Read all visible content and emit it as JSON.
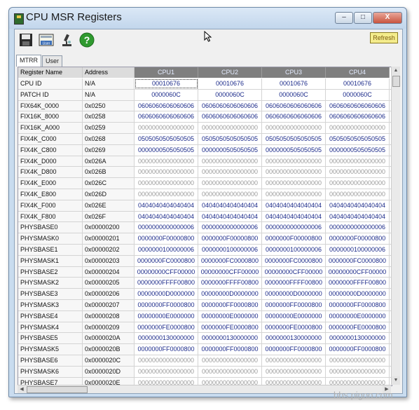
{
  "window": {
    "title": "CPU MSR Registers",
    "min": "–",
    "max": "□",
    "close": "X"
  },
  "toolbar": {
    "refresh_label": "Refresh",
    "user_label": "User",
    "help_label": "?"
  },
  "tabs": [
    {
      "label": "MTRR",
      "active": true
    },
    {
      "label": "User",
      "active": false
    }
  ],
  "columns": {
    "name": "Register Name",
    "address": "Address",
    "cpus": [
      "CPU1",
      "CPU2",
      "CPU3",
      "CPU4"
    ]
  },
  "rows": [
    {
      "name": "CPU ID",
      "address": "N/A",
      "value": "00010676"
    },
    {
      "name": "PATCH ID",
      "address": "N/A",
      "value": "0000060C"
    },
    {
      "name": "FIX64K_0000",
      "address": "0x0250",
      "value": "0606060606060606"
    },
    {
      "name": "FIX16K_8000",
      "address": "0x0258",
      "value": "0606060606060606"
    },
    {
      "name": "FIX16K_A000",
      "address": "0x0259",
      "value": "0000000000000000"
    },
    {
      "name": "FIX4K_C000",
      "address": "0x0268",
      "value": "0505050505050505"
    },
    {
      "name": "FIX4K_C800",
      "address": "0x0269",
      "value": "0000000505050505"
    },
    {
      "name": "FIX4K_D000",
      "address": "0x026A",
      "value": "0000000000000000"
    },
    {
      "name": "FIX4K_D800",
      "address": "0x026B",
      "value": "0000000000000000"
    },
    {
      "name": "FIX4K_E000",
      "address": "0x026C",
      "value": "0000000000000000"
    },
    {
      "name": "FIX4K_E800",
      "address": "0x026D",
      "value": "0000000000000000"
    },
    {
      "name": "FIX4K_F000",
      "address": "0x026E",
      "value": "0404040404040404"
    },
    {
      "name": "FIX4K_F800",
      "address": "0x026F",
      "value": "0404040404040404"
    },
    {
      "name": "PHYSBASE0",
      "address": "0x00000200",
      "value": "0000000000000006"
    },
    {
      "name": "PHYSMASK0",
      "address": "0x00000201",
      "value": "0000000F00000800"
    },
    {
      "name": "PHYSBASE1",
      "address": "0x00000202",
      "value": "0000000100000006"
    },
    {
      "name": "PHYSMASK1",
      "address": "0x00000203",
      "value": "0000000FC0000800"
    },
    {
      "name": "PHYSBASE2",
      "address": "0x00000204",
      "value": "00000000CFF00000"
    },
    {
      "name": "PHYSMASK2",
      "address": "0x00000205",
      "value": "0000000FFFF00800"
    },
    {
      "name": "PHYSBASE3",
      "address": "0x00000206",
      "value": "00000000D0000000"
    },
    {
      "name": "PHYSMASK3",
      "address": "0x00000207",
      "value": "0000000FF0000800"
    },
    {
      "name": "PHYSBASE4",
      "address": "0x00000208",
      "value": "00000000E0000000"
    },
    {
      "name": "PHYSMASK4",
      "address": "0x00000209",
      "value": "0000000FE0000800"
    },
    {
      "name": "PHYSBASE5",
      "address": "0x0000020A",
      "value": "0000000130000000"
    },
    {
      "name": "PHYSMASK5",
      "address": "0x0000020B",
      "value": "0000000FF0000800"
    },
    {
      "name": "PHYSBASE6",
      "address": "0x0000020C",
      "value": "0000000000000000"
    },
    {
      "name": "PHYSMASK6",
      "address": "0x0000020D",
      "value": "0000000000000000"
    },
    {
      "name": "PHYSBASE7",
      "address": "0x0000020E",
      "value": "0000000000000000"
    }
  ],
  "colors": {
    "value_text": "#1b2a8a",
    "zero_text": "#9a9a9a",
    "cpu_header": "#7f7f7f",
    "refresh_bg": "#f4ec8c"
  },
  "icons": [
    "save-icon",
    "user-icon",
    "microscope-icon",
    "help-icon"
  ],
  "watermark": "bbs.pigoo.com"
}
